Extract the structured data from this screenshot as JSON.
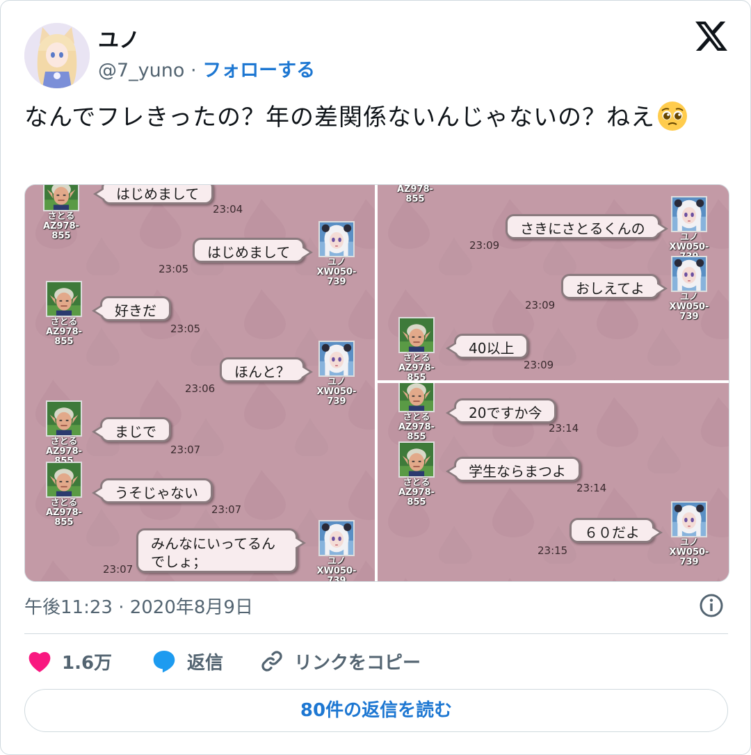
{
  "author": {
    "name": "ユノ",
    "handle": "@7_yuno",
    "separator": "·",
    "follow_label": "フォローする"
  },
  "tweet": {
    "text": "なんでフレきったの？年の差関係ないんじゃないの？ねえ"
  },
  "emoji": {
    "name": "pleading-face-emoji"
  },
  "chat": {
    "satoru_name": "さとる",
    "satoru_id": "AZ978-855",
    "yuno_name": "ユノ",
    "yuno_id": "XW050-739",
    "left": [
      {
        "text": "はじめまして",
        "time": "23:04"
      },
      {
        "text": "はじめまして",
        "time": "23:05"
      },
      {
        "text": "好きだ",
        "time": "23:05"
      },
      {
        "text": "ほんと？",
        "time": "23:06"
      },
      {
        "text": "まじで",
        "time": "23:07"
      },
      {
        "text": "うそじゃない",
        "time": "23:07"
      },
      {
        "text": "みんなにいってるんでしょ；",
        "time": "23:07"
      }
    ],
    "top_right": [
      {
        "text": "さきにさとるくんの",
        "time": "23:09"
      },
      {
        "text": "おしえてよ",
        "time": "23:09"
      },
      {
        "text": "40以上",
        "time": "23:09"
      }
    ],
    "bottom_right": [
      {
        "text": "20ですか今",
        "time": "23:14"
      },
      {
        "text": "学生ならまつよ",
        "time": "23:14"
      },
      {
        "text": "６０だよ",
        "time": "23:15"
      }
    ]
  },
  "meta": {
    "datetime": "午後11:23 · 2020年8月9日"
  },
  "actions": {
    "like_count": "1.6万",
    "reply_label": "返信",
    "copy_link_label": "リンクをコピー"
  },
  "read_replies": {
    "label": "80件の返信を読む"
  },
  "colors": {
    "accent": "#1d77d2",
    "like": "#f91880",
    "reply": "#1d9bf0",
    "chat_bg": "#c39aa6"
  }
}
